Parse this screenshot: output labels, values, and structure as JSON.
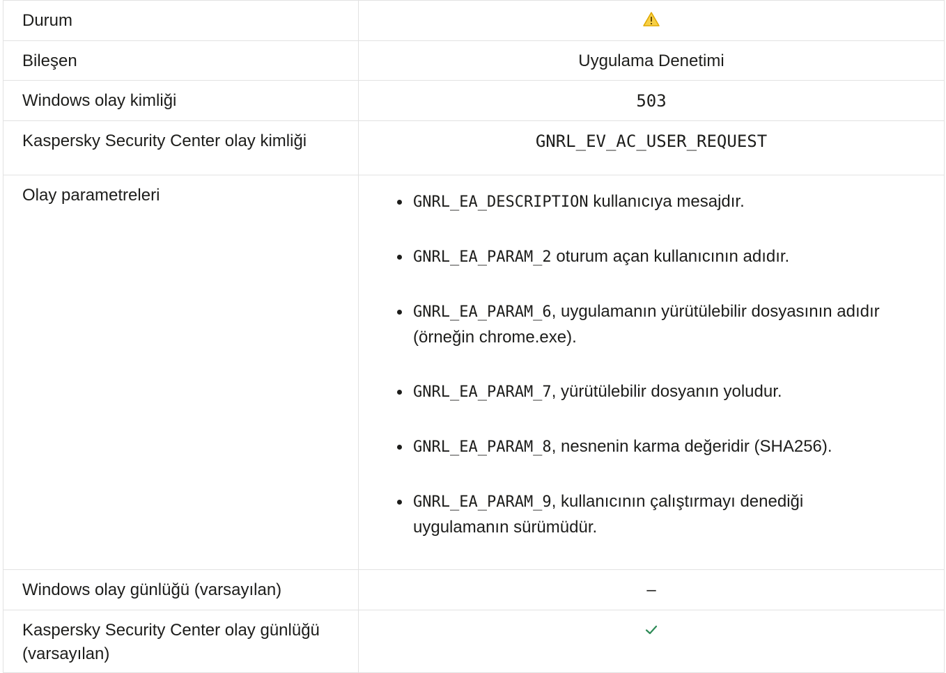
{
  "rows": {
    "status": {
      "label": "Durum",
      "icon": "warning-icon",
      "icon_color": "#f5c518"
    },
    "component": {
      "label": "Bileşen",
      "value": "Uygulama Denetimi"
    },
    "windows_event_id": {
      "label": "Windows olay kimliği",
      "value": "503"
    },
    "ksc_event_id": {
      "label": "Kaspersky Security Center olay kimliği",
      "value": "GNRL_EV_AC_USER_REQUEST"
    },
    "event_params": {
      "label": "Olay parametreleri",
      "items": [
        {
          "code": "GNRL_EA_DESCRIPTION",
          "text": " kullanıcıya mesajdır."
        },
        {
          "code": "GNRL_EA_PARAM_2",
          "text": " oturum açan kullanıcının adıdır."
        },
        {
          "code": "GNRL_EA_PARAM_6",
          "text": ", uygulamanın yürütülebilir dosyasının adıdır (örneğin chrome.exe)."
        },
        {
          "code": "GNRL_EA_PARAM_7",
          "text": ", yürütülebilir dosyanın yoludur."
        },
        {
          "code": "GNRL_EA_PARAM_8",
          "text": ", nesnenin karma değeridir (SHA256)."
        },
        {
          "code": "GNRL_EA_PARAM_9",
          "text": ", kullanıcının çalıştırmayı denediği uygulamanın sürümüdür."
        }
      ]
    },
    "windows_log": {
      "label": "Windows olay günlüğü (varsayılan)",
      "value": "–"
    },
    "ksc_log": {
      "label": "Kaspersky Security Center olay günlüğü (varsayılan)",
      "icon": "checkmark-icon",
      "icon_color": "#2e8b57"
    }
  }
}
